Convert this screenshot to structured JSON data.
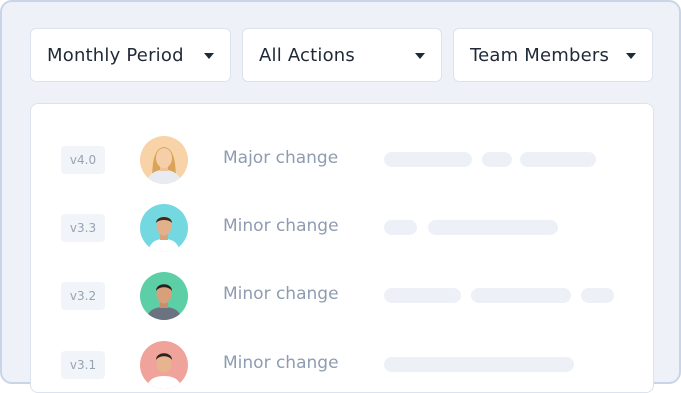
{
  "filters": [
    {
      "label": "Monthly Period"
    },
    {
      "label": "All Actions"
    },
    {
      "label": "Team Members"
    }
  ],
  "activity": [
    {
      "version": "v4.0",
      "change": "Major change",
      "avatar_bg": "#f9d3a8",
      "shirt": "#e8ecf2",
      "hair": "#d9a45a"
    },
    {
      "version": "v3.3",
      "change": "Minor change",
      "avatar_bg": "#74d8e1",
      "shirt": "#ffffff",
      "hair": "#3a2a22"
    },
    {
      "version": "v3.2",
      "change": "Minor change",
      "avatar_bg": "#5ccfa6",
      "shirt": "#6b7280",
      "hair": "#2a211b"
    },
    {
      "version": "v3.1",
      "change": "Minor change",
      "avatar_bg": "#f0a39a",
      "shirt": "#ffffff",
      "hair": "#2b2320"
    }
  ]
}
